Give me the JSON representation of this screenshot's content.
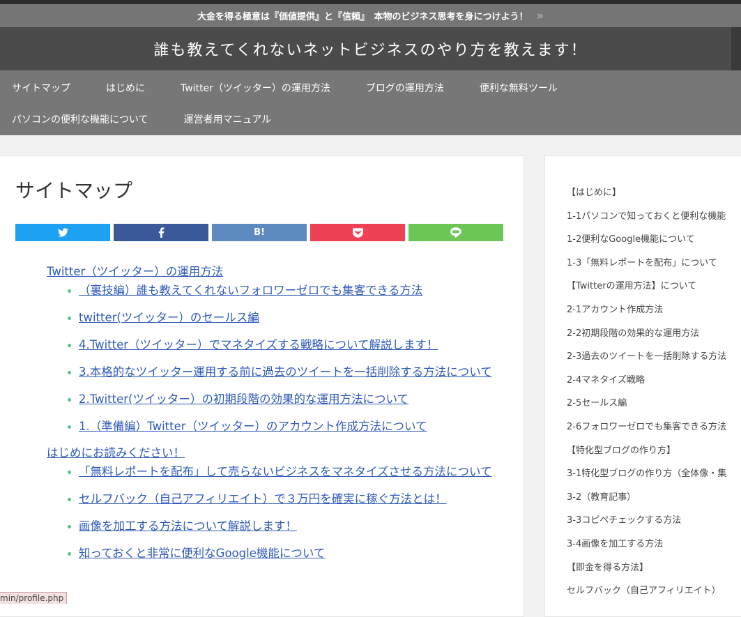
{
  "notice": {
    "text": "大金を得る極意は『価値提供』と『信頼』　本物のビジネス思考を身につけよう！",
    "arrow": "»"
  },
  "header": {
    "title": "誰も教えてくれないネットビジネスのやり方を教えます！"
  },
  "nav": {
    "row1": [
      "サイトマップ",
      "はじめに",
      "Twitter（ツイッター）の運用方法",
      "ブログの運用方法",
      "便利な無料ツール"
    ],
    "row2": [
      "パソコンの便利な機能について",
      "運営者用マニュアル"
    ]
  },
  "page": {
    "title": "サイトマップ"
  },
  "share": {
    "hatena": "B!"
  },
  "sitemap": {
    "categories": [
      {
        "name": "Twitter（ツイッター）の運用方法",
        "posts": [
          "（裏技編）誰も教えてくれないフォロワーゼロでも集客できる方法",
          "twitter(ツイッター）のセールス編",
          "4.Twitter（ツイッター）でマネタイズする戦略について解説します！",
          "3.本格的なツイッター運用する前に過去のツイートを一括削除する方法について",
          "2.Twitter(ツイッター）の初期段階の効果的な運用方法について",
          "1.（準備編）Twitter（ツイッター）のアカウント作成方法について"
        ]
      },
      {
        "name": "はじめにお読みください！",
        "posts": [
          "「無料レポートを配布」して売らないビジネスをマネタイズさせる方法について",
          "セルフバック（自己アフィリエイト）で３万円を確実に稼ぐ方法とは！",
          "画像を加工する方法について解説します！",
          "知っておくと非常に便利なGoogle機能について"
        ]
      }
    ]
  },
  "sidebar": {
    "items": [
      "【はじめに】",
      "1-1パソコンで知っておくと便利な機能",
      "1-2便利なGoogle機能について",
      "1-3「無料レポートを配布」について",
      "【Twitterの運用方法】について",
      "2-1アカウント作成方法",
      "2-2初期段階の効果的な運用方法",
      "2-3過去のツイートを一括削除する方法",
      "2-4マネタイズ戦略",
      "2-5セールス編",
      "2-6フォロワーゼロでも集客できる方法",
      "【特化型ブログの作り方】",
      "3-1特化型ブログの作り方（全体像・集",
      "3-2（教育記事）",
      "3-3コピペチェックする方法",
      "3-4画像を加工する方法",
      "【即金を得る方法】",
      "セルフバック（自己アフィリエイト）"
    ]
  },
  "status": {
    "url": "min/profile.php"
  }
}
